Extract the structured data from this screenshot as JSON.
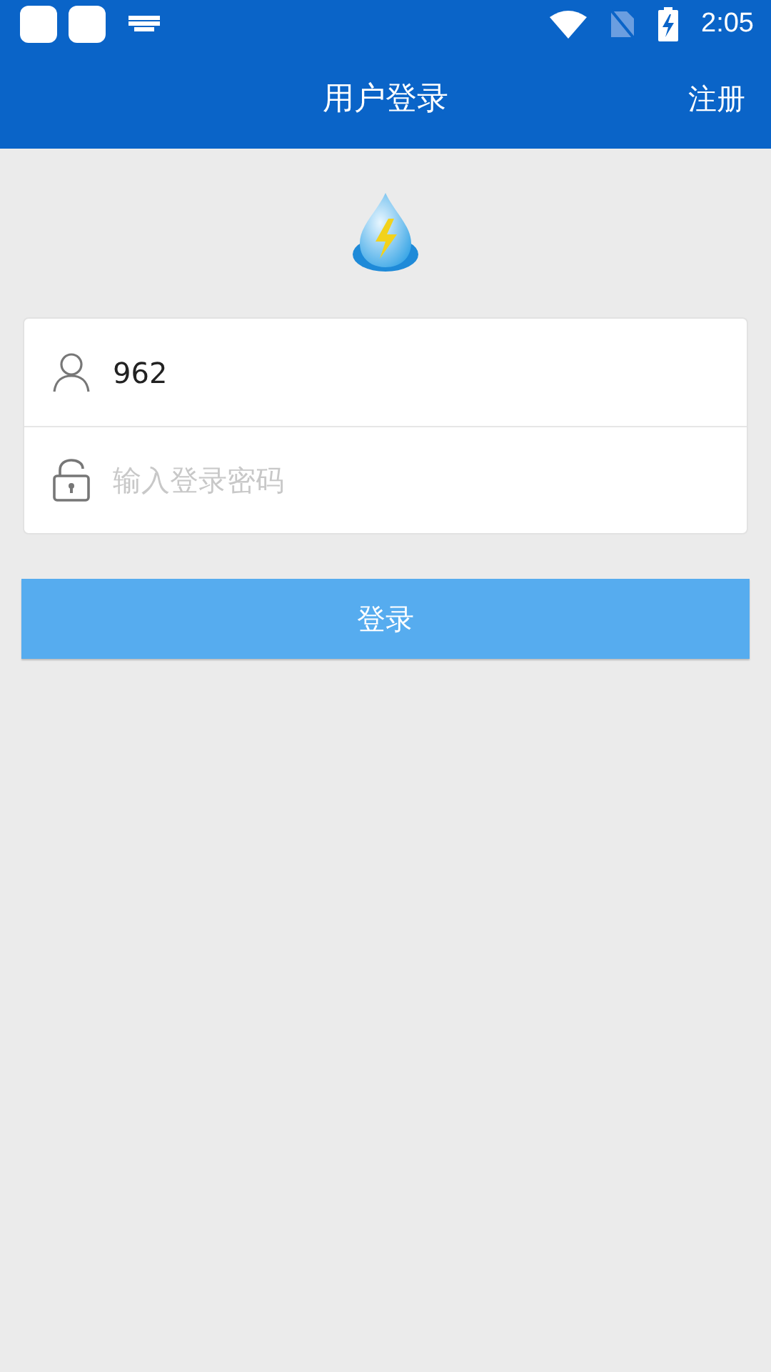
{
  "status_bar": {
    "time": "2:05"
  },
  "header": {
    "title": "用户登录",
    "action": "注册"
  },
  "form": {
    "username": {
      "value": "962"
    },
    "password": {
      "placeholder": "输入登录密码"
    }
  },
  "login_button": "登录"
}
